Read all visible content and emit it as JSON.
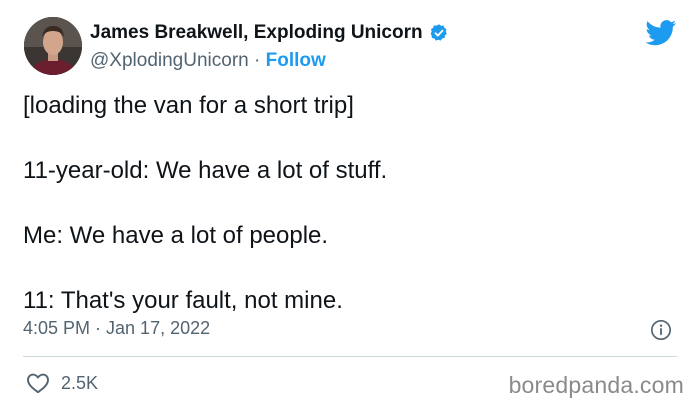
{
  "author": {
    "display_name": "James Breakwell, Exploding Unicorn",
    "handle": "@XplodingUnicorn",
    "separator": " · ",
    "follow_label": "Follow",
    "verified_icon": "verified-badge-icon",
    "avatar": "avatar"
  },
  "tweet": {
    "lines": [
      "[loading the van for a short trip]",
      "11-year-old: We have a lot of stuff.",
      "Me: We have a lot of people.",
      "11: That's your fault, not mine."
    ],
    "timestamp": "4:05 PM · Jan 17, 2022",
    "likes": "2.5K"
  },
  "icons": {
    "brand": "twitter-bird-icon",
    "info": "info-icon",
    "like": "heart-icon"
  },
  "watermark": "boredpanda.com",
  "colors": {
    "accent": "#1d9bf0",
    "text": "#0f1419",
    "muted": "#536471",
    "divider": "#cfd9de",
    "watermark": "#8a8a8a"
  }
}
